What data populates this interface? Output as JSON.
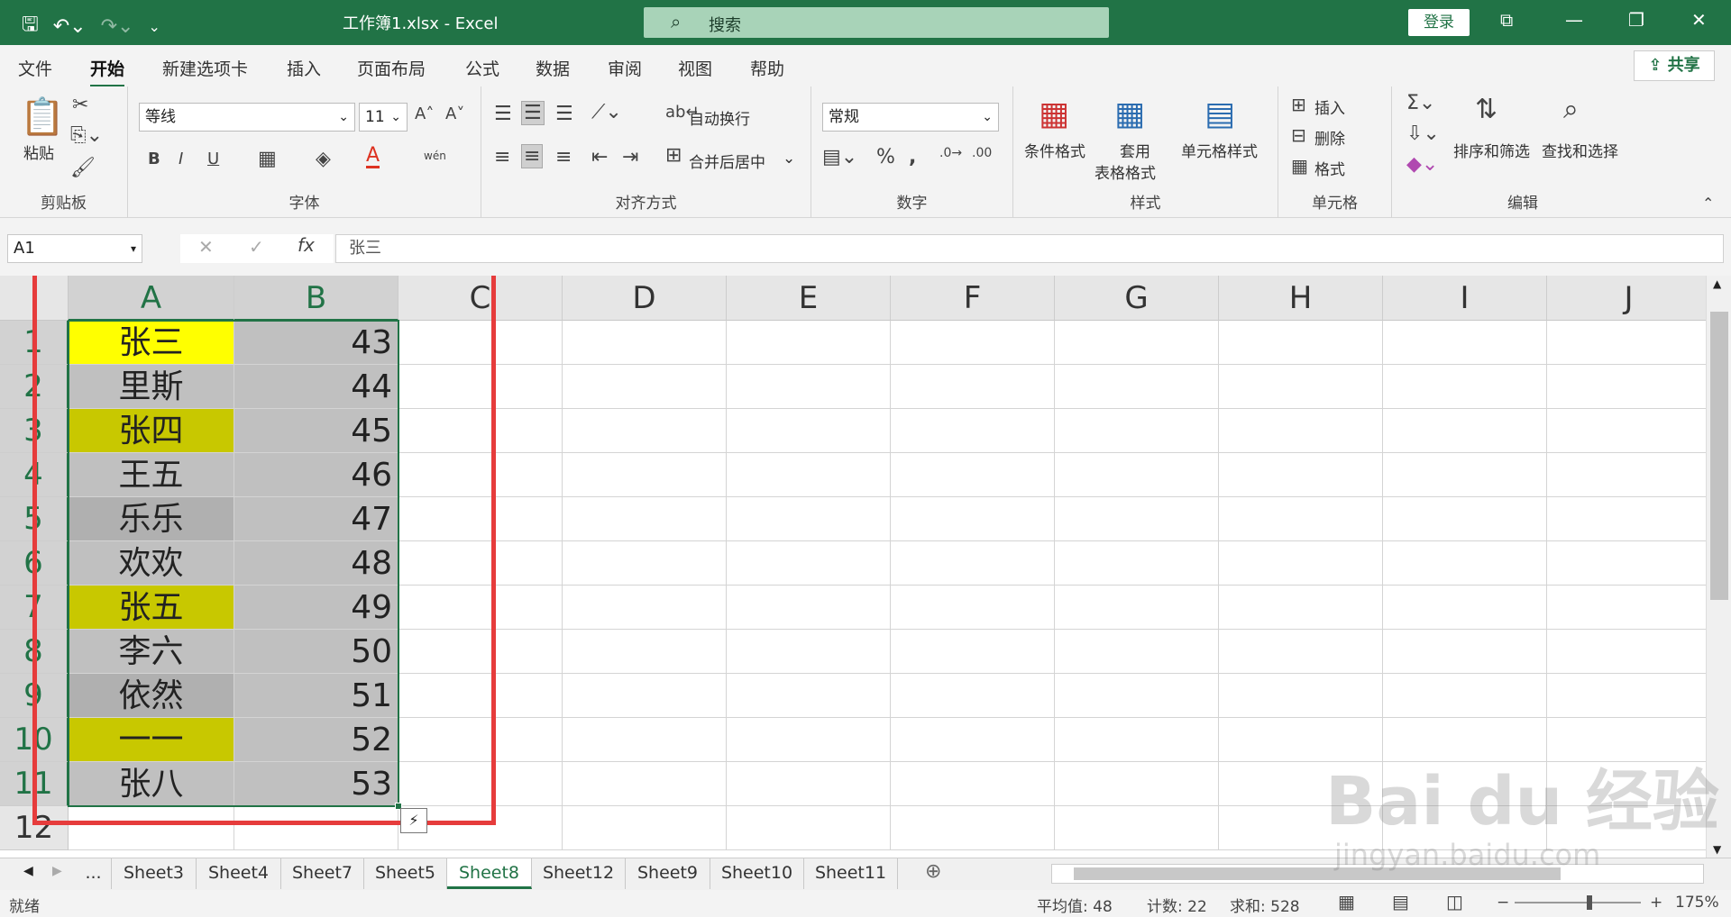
{
  "app": {
    "window_title": "工作簿1.xlsx  -  Excel",
    "search_placeholder": "搜索",
    "login_label": "登录",
    "share_label": "共享",
    "accent_color": "#217346"
  },
  "menu": {
    "tabs": [
      "文件",
      "开始",
      "新建选项卡",
      "插入",
      "页面布局",
      "公式",
      "数据",
      "审阅",
      "视图",
      "帮助"
    ],
    "active": "开始"
  },
  "ribbon": {
    "clipboard": {
      "paste": "粘贴",
      "group": "剪贴板"
    },
    "font": {
      "name": "等线",
      "size": "11",
      "group": "字体",
      "bold": "B",
      "italic": "I",
      "underline": "U",
      "wen": "wén"
    },
    "alignment": {
      "wrap": "自动换行",
      "merge": "合并后居中",
      "group": "对齐方式"
    },
    "number": {
      "format": "常规",
      "group": "数字"
    },
    "styles": {
      "conditional": "条件格式",
      "table_1": "套用",
      "table_2": "表格格式",
      "cell_styles": "单元格样式",
      "group": "样式"
    },
    "cells": {
      "insert": "插入",
      "delete": "删除",
      "format": "格式",
      "group": "单元格"
    },
    "editing": {
      "sort": "排序和筛选",
      "find": "查找和选择",
      "group": "编辑"
    }
  },
  "formula_bar": {
    "name_box": "A1",
    "content": "张三"
  },
  "grid": {
    "columns": [
      "A",
      "B",
      "C",
      "D",
      "E",
      "F",
      "G",
      "H",
      "I",
      "J"
    ],
    "rows": [
      "1",
      "2",
      "3",
      "4",
      "5",
      "6",
      "7",
      "8",
      "9",
      "10",
      "11",
      "12"
    ],
    "col_a": [
      "张三",
      "里斯",
      "张四",
      "王五",
      "乐乐",
      "欢欢",
      "张五",
      "李六",
      "依然",
      "一一",
      "张八"
    ],
    "col_b": [
      "43",
      "44",
      "45",
      "46",
      "47",
      "48",
      "49",
      "50",
      "51",
      "52",
      "53"
    ],
    "col_a_fill": [
      "#ffff00",
      "#c0c0c0",
      "#c8c800",
      "#c0c0c0",
      "#b0b0b0",
      "#c0c0c0",
      "#c8c800",
      "#c0c0c0",
      "#b0b0b0",
      "#c8c800",
      "#c0c0c0"
    ],
    "col_b_fill": "#c0c0c0",
    "highlight_color": "#e63c3c"
  },
  "sheets": {
    "tabs": [
      "Sheet3",
      "Sheet4",
      "Sheet7",
      "Sheet5",
      "Sheet8",
      "Sheet12",
      "Sheet9",
      "Sheet10",
      "Sheet11"
    ],
    "active": "Sheet8",
    "more": "..."
  },
  "status": {
    "ready": "就绪",
    "average": "平均值: 48",
    "count": "计数: 22",
    "sum": "求和: 528",
    "zoom": "175%"
  },
  "watermark": {
    "brand": "Bai du 经验",
    "url": "jingyan.baidu.com"
  }
}
